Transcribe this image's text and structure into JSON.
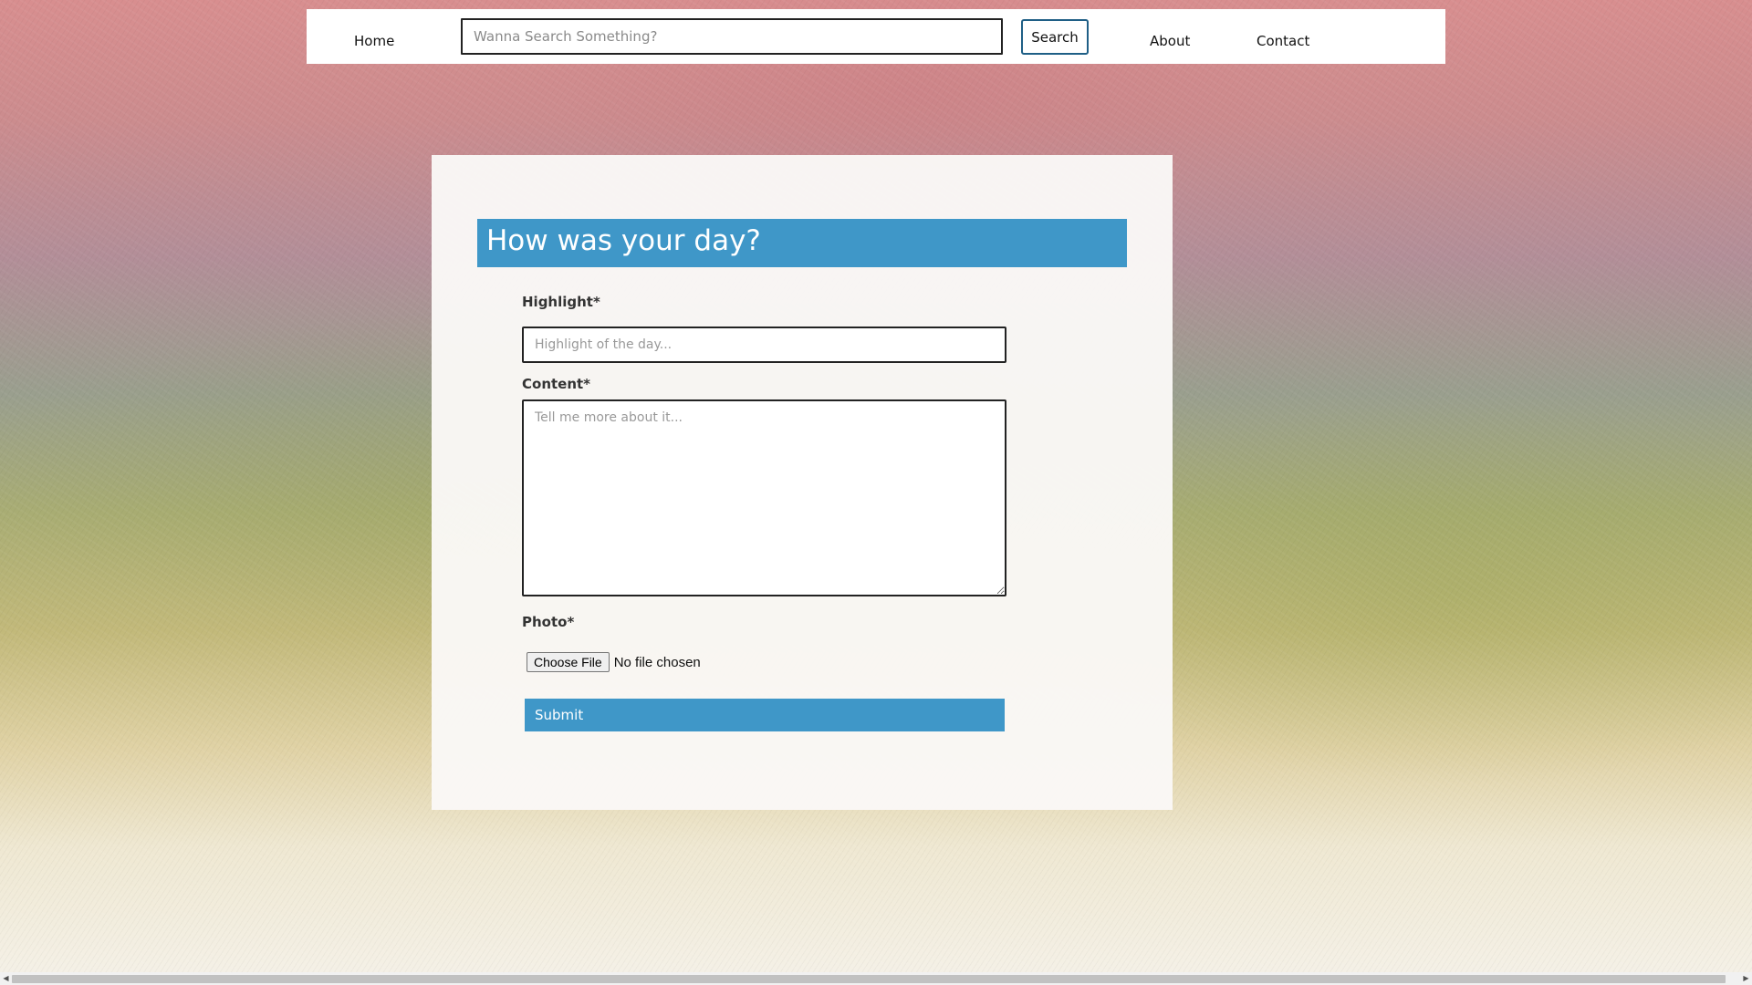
{
  "navbar": {
    "home_label": "Home",
    "search_placeholder": "Wanna Search Something?",
    "search_button_label": "Search",
    "about_label": "About",
    "contact_label": "Contact"
  },
  "form": {
    "title": "How was your day?",
    "highlight_label": "Highlight*",
    "highlight_placeholder": "Highlight of the day...",
    "content_label": "Content*",
    "content_placeholder": "Tell me more about it...",
    "photo_label": "Photo*",
    "choose_file_label": "Choose File",
    "file_status": "No file chosen",
    "submit_label": "Submit"
  },
  "colors": {
    "accent": "#3f97c8",
    "search_button_border": "#1f5f86"
  },
  "scrollbar": {
    "left_arrow_icon": "arrow-left-icon",
    "right_arrow_icon": "arrow-right-icon"
  }
}
